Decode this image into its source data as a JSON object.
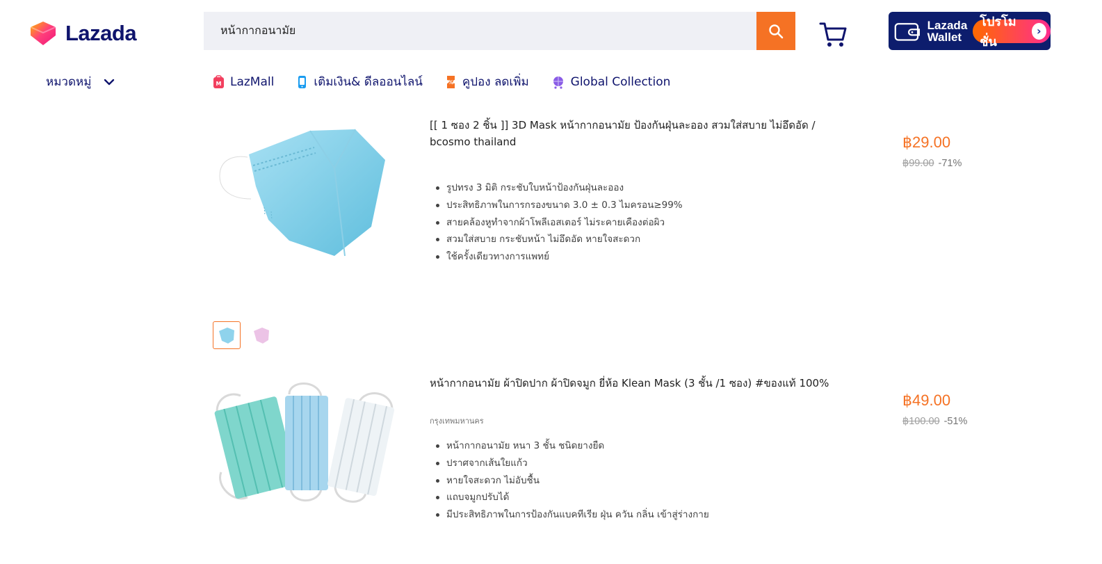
{
  "header": {
    "logo_text": "Lazada",
    "search": {
      "value": "หน้ากากอนามัย",
      "button_icon": "search-icon"
    },
    "cart_icon": "cart-icon",
    "wallet_banner": {
      "line1": "Lazada",
      "line2": "Wallet",
      "promo": "โปรโมชั่น"
    }
  },
  "nav": {
    "category_label": "หมวดหมู่",
    "items": [
      {
        "label": "LazMall",
        "icon": "lazmall-icon",
        "color": "#f23f5e"
      },
      {
        "label": "เติมเงิน& ดีลออนไลน์",
        "icon": "phone-topup-icon",
        "color": "#1a9cf0"
      },
      {
        "label": "คูปอง ลดเพิ่ม",
        "icon": "coupon-icon",
        "color": "#f57224"
      },
      {
        "label": "Global Collection",
        "icon": "global-cart-icon",
        "color": "#8a5ce6"
      }
    ]
  },
  "products": [
    {
      "title": "[[ 1 ซอง 2 ชิ้น ]] 3D Mask หน้ากากอนามัย ป้องกันฝุ่นละออง สวมใส่สบาย ไม่อึดอัด / bcosmo thailand",
      "location": "",
      "features": [
        "รูปทรง 3 มิติ กระชับใบหน้าป้องกันฝุ่นละออง",
        "ประสิทธิภาพในการกรองขนาด 3.0 ± 0.3 ไมครอน≥99%",
        "สายคล้องหูทำจากผ้าโพลีเอสเตอร์ ไม่ระคายเคืองต่อผิว",
        "สวมใส่สบาย กระชับหน้า ไม่อึดอัด หายใจสะดวก",
        "ใช้ครั้งเดียวทางการแพทย์"
      ],
      "price": "฿29.00",
      "original_price": "฿99.00",
      "discount": "-71%"
    },
    {
      "title": "หน้ากากอนามัย ผ้าปิดปาก ผ้าปิดจมูก ยี่ห้อ Klean Mask (3 ชั้น /1 ซอง) #ของแท้ 100%",
      "location": "กรุงเทพมหานคร",
      "features": [
        "หน้ากากอนามัย หนา 3 ชั้น ชนิดยางยืด",
        "ปราศจากเส้นใยแก้ว",
        "หายใจสะดวก ไม่อับชื้น",
        "แถบจมูกปรับได้",
        "มีประสิทธิภาพในการป้องกันแบคทีเรีย ฝุ่น ควัน กลิ่น เข้าสู่ร่างกาย"
      ],
      "price": "฿49.00",
      "original_price": "฿100.00",
      "discount": "-51%"
    }
  ],
  "colors": {
    "accent": "#f57224",
    "brand": "#0f146d",
    "search_bg": "#eff0f5"
  }
}
